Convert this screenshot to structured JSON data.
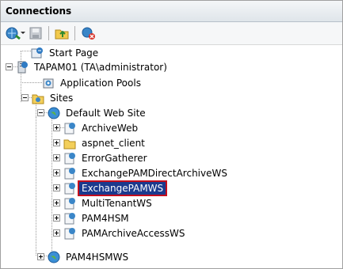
{
  "panel": {
    "title": "Connections"
  },
  "toolbar": {
    "icons": [
      "connect-icon",
      "save-icon",
      "up-folder-icon",
      "disconnect-icon"
    ]
  },
  "tree": {
    "start_page": "Start Page",
    "server": "TAPAM01 (TA\\administrator)",
    "app_pools": "Application Pools",
    "sites": "Sites",
    "default_site": "Default Web Site",
    "site_children": [
      "ArchiveWeb",
      "aspnet_client",
      "ErrorGatherer",
      "ExchangePAMDirectArchiveWS",
      "ExchangePAMWS",
      "MultiTenantWS",
      "PAM4HSM",
      "PAMArchiveAccessWS"
    ],
    "pam4hsmws": "PAM4HSMWS",
    "selected": "ExchangePAMWS"
  },
  "colors": {
    "selection_bg": "#1b3a8e",
    "selection_border": "#c40d1d",
    "header_bg": "#dfe5ea"
  }
}
